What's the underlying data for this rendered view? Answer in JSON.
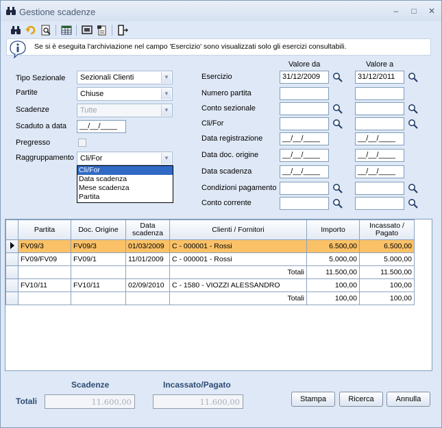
{
  "window": {
    "title": "Gestione scadenze",
    "minimize": "–",
    "maximize": "□",
    "close": "✕"
  },
  "info": {
    "text": "Se si è eseguita l'archiviazione nel campo 'Esercizio' sono visualizzati solo gli esercizi consultabili."
  },
  "filters": {
    "tipo_sezionale": {
      "label": "Tipo Sezionale",
      "value": "Sezionali Clienti"
    },
    "partite": {
      "label": "Partite",
      "value": "Chiuse"
    },
    "scadenze": {
      "label": "Scadenze",
      "value": "Tutte"
    },
    "scaduto_a_data": {
      "label": "Scaduto a data",
      "value": "__/__/____"
    },
    "pregresso": {
      "label": "Pregresso",
      "checked": false
    },
    "raggruppamento": {
      "label": "Raggruppamento",
      "value": "Cli/For",
      "options": [
        "Cli/For",
        "Data scadenza",
        "Mese scadenza",
        "Partita"
      ]
    }
  },
  "range": {
    "header_da": "Valore da",
    "header_a": "Valore a",
    "rows": [
      {
        "label": "Esercizio",
        "da": "31/12/2009",
        "a": "31/12/2011",
        "search": true
      },
      {
        "label": "Numero partita",
        "da": "",
        "a": "",
        "search": false
      },
      {
        "label": "Conto sezionale",
        "da": "",
        "a": "",
        "search": true
      },
      {
        "label": "Cli/For",
        "da": "",
        "a": "",
        "search": true
      },
      {
        "label": "Data registrazione",
        "da": "__/__/____",
        "a": "__/__/____",
        "search": false
      },
      {
        "label": "Data doc. origine",
        "da": "__/__/____",
        "a": "__/__/____",
        "search": false
      },
      {
        "label": "Data scadenza",
        "da": "__/__/____",
        "a": "__/__/____",
        "search": false
      },
      {
        "label": "Condizioni pagamento",
        "da": "",
        "a": "",
        "search": true
      },
      {
        "label": "Conto corrente",
        "da": "",
        "a": "",
        "search": true
      }
    ]
  },
  "grid": {
    "columns": [
      "Partita",
      "Doc. Origine",
      "Data scadenza",
      "Clienti / Fornitori",
      "Importo",
      "Incassato / Pagato"
    ],
    "rows": [
      {
        "kind": "data",
        "selected": true,
        "cells": [
          "FV09/3",
          "FV09/3",
          "01/03/2009",
          "C - 000001 - Rossi",
          "6.500,00",
          "6.500,00"
        ]
      },
      {
        "kind": "data",
        "selected": false,
        "cells": [
          "FV09/FV09",
          "FV09/1",
          "11/01/2009",
          "C - 000001 - Rossi",
          "5.000,00",
          "5.000,00"
        ]
      },
      {
        "kind": "total",
        "label": "Totali",
        "importo": "11.500,00",
        "pagato": "11.500,00"
      },
      {
        "kind": "data",
        "selected": false,
        "cells": [
          "FV10/11",
          "FV10/11",
          "02/09/2010",
          "C - 1580 - VIOZZI ALESSANDRO",
          "100,00",
          "100,00"
        ]
      },
      {
        "kind": "total",
        "label": "Totali",
        "importo": "100,00",
        "pagato": "100,00"
      }
    ]
  },
  "footer": {
    "label_totali": "Totali",
    "header_scadenze": "Scadenze",
    "header_pagato": "Incassato/Pagato",
    "scadenze": "11.600,00",
    "pagato": "11.600,00"
  },
  "buttons": {
    "stampa": "Stampa",
    "ricerca": "Ricerca",
    "annulla": "Annulla"
  }
}
